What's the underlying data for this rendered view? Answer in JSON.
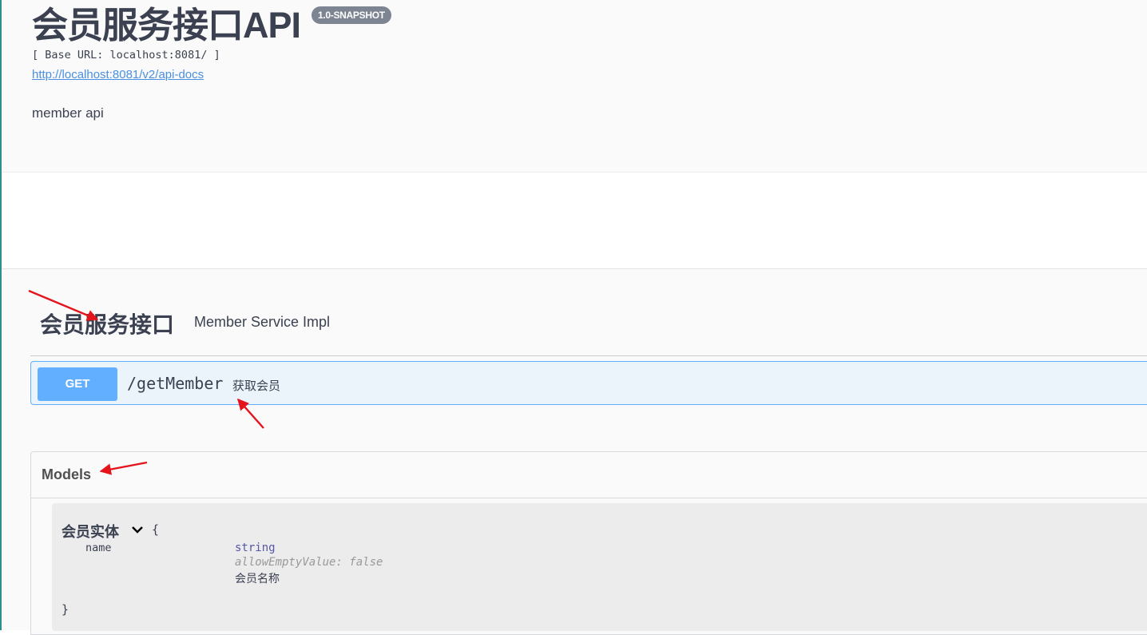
{
  "info": {
    "title": "会员服务接口API",
    "version": "1.0-SNAPSHOT",
    "base_url": "[ Base URL: localhost:8081/ ]",
    "spec_link": "http://localhost:8081/v2/api-docs",
    "description": "member api"
  },
  "tag": {
    "name": "会员服务接口",
    "description": "Member Service Impl"
  },
  "operation": {
    "method": "GET",
    "path": "/getMember",
    "summary": "获取会员"
  },
  "models": {
    "title": "Models",
    "model": {
      "name": "会员实体",
      "open_brace": "{",
      "close_brace": "}",
      "property": {
        "name": "name",
        "type": "string",
        "extra": "allowEmptyValue: false",
        "description": "会员名称"
      }
    }
  },
  "colors": {
    "get_method": "#61affe",
    "get_bg": "#ebf3fb",
    "annotation_arrow": "#e5141c",
    "link": "#4990e2"
  },
  "icons": {
    "model_toggle": "chevron-down-icon",
    "annotation": "red-arrow-icon"
  }
}
